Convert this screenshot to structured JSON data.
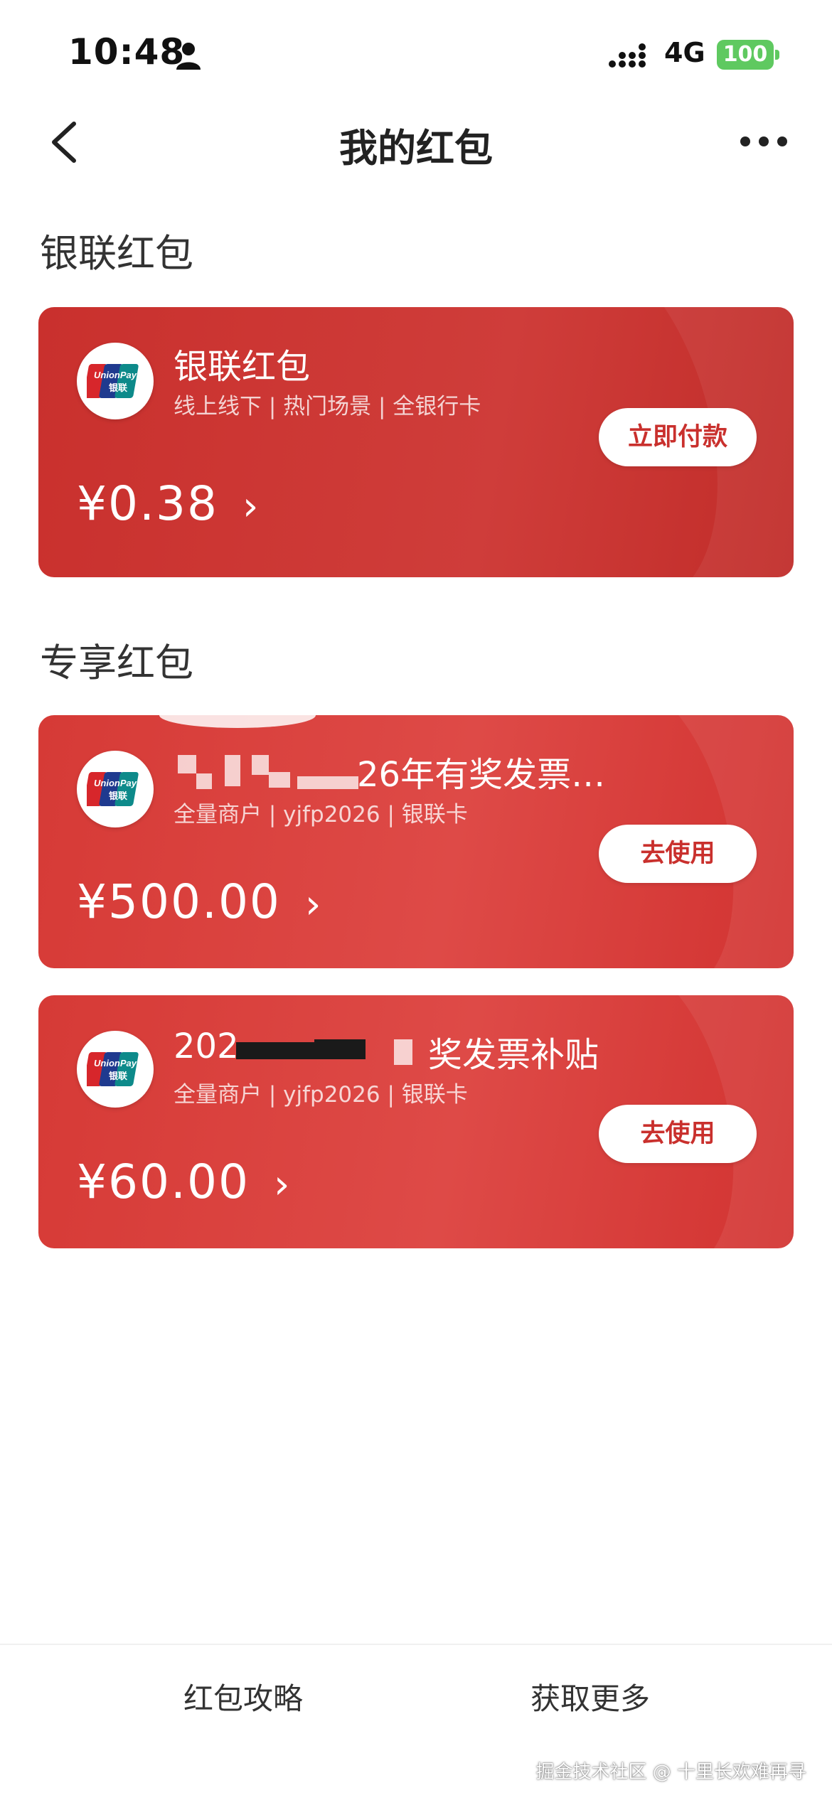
{
  "status_bar": {
    "time": "10:48",
    "network": "4G",
    "battery": "100"
  },
  "nav": {
    "title": "我的红包"
  },
  "sections": {
    "unionpay_label": "银联红包",
    "exclusive_label": "专享红包"
  },
  "cards": [
    {
      "title": "银联红包",
      "subtitle": "线上线下 | 热门场景 | 全银行卡",
      "amount": "¥0.38",
      "button": "立即付款"
    },
    {
      "title": "26年有奖发票…",
      "subtitle": "全量商户 | yjfp2026 | 银联卡",
      "amount": "¥500.00",
      "button": "去使用"
    },
    {
      "title_prefix": "202",
      "title": "奖发票补贴",
      "subtitle": "全量商户 | yjfp2026 | 银联卡",
      "amount": "¥60.00",
      "button": "去使用"
    }
  ],
  "bottom": {
    "left": "红包攻略",
    "right": "获取更多",
    "watermark": "掘金技术社区 @ 十里长欢难再寻"
  },
  "colors": {
    "card_red": "#d63a36",
    "button_text": "#c9302d",
    "battery_green": "#5fc960"
  },
  "icons": {
    "logo": "unionpay-logo",
    "back": "chevron-left-icon",
    "more": "more-dots-icon"
  }
}
